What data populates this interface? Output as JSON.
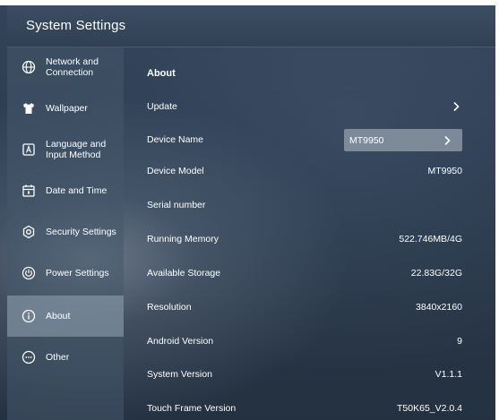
{
  "window": {
    "title": "System Settings"
  },
  "sidebar": {
    "items": [
      {
        "label": "Network and Connection",
        "icon": "globe-icon",
        "active": false
      },
      {
        "label": "Wallpaper",
        "icon": "shirt-icon",
        "active": false
      },
      {
        "label": "Language and Input Method",
        "icon": "keyboard-a-icon",
        "active": false
      },
      {
        "label": "Date and Time",
        "icon": "calendar-icon",
        "active": false
      },
      {
        "label": "Security Settings",
        "icon": "security-gear-icon",
        "active": false
      },
      {
        "label": "Power Settings",
        "icon": "power-icon",
        "active": false
      },
      {
        "label": "About",
        "icon": "info-icon",
        "active": true
      },
      {
        "label": "Other",
        "icon": "more-icon",
        "active": false
      }
    ]
  },
  "about": {
    "section_title": "About",
    "update": {
      "label": "Update"
    },
    "device_name": {
      "label": "Device Name",
      "value": "MT9950"
    },
    "device_model": {
      "label": "Device Model",
      "value": "MT9950"
    },
    "serial_number": {
      "label": "Serial number",
      "value": ""
    },
    "running_memory": {
      "label": "Running Memory",
      "value": "522.746MB/4G"
    },
    "available_storage": {
      "label": "Available Storage",
      "value": "22.83G/32G"
    },
    "resolution": {
      "label": "Resolution",
      "value": "3840x2160"
    },
    "android_version": {
      "label": "Android Version",
      "value": "9"
    },
    "system_version": {
      "label": "System Version",
      "value": "V1.1.1"
    },
    "touch_frame_version": {
      "label": "Touch Frame Version",
      "value": "T50K65_V2.0.4"
    }
  },
  "colors": {
    "text": "#ffffff",
    "active_item": "#96a5b4",
    "background": "#2b3b50"
  }
}
